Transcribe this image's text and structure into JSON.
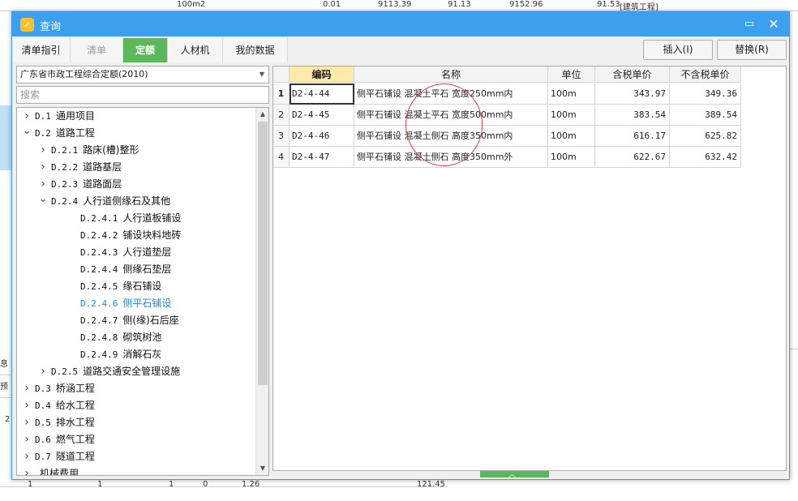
{
  "window": {
    "title": "查询",
    "app_icon": "app-logo-icon",
    "max_icon": "maximize-icon",
    "close_icon": "close-icon"
  },
  "background": {
    "top_row": [
      "100m2",
      "0.01",
      "9113.39",
      "91.13",
      "9152.96",
      "91.53",
      "[建筑工程]"
    ],
    "bottom_row": [
      "1",
      "1",
      "1",
      "0",
      "1.26",
      "121.45"
    ],
    "side_labels": [
      "息",
      "预",
      "2"
    ]
  },
  "tabs": [
    {
      "label": "清单指引",
      "state": "normal"
    },
    {
      "label": "清单",
      "state": "disabled"
    },
    {
      "label": "定额",
      "state": "active"
    },
    {
      "label": "人材机",
      "state": "normal"
    },
    {
      "label": "我的数据",
      "state": "normal"
    }
  ],
  "toolbar": {
    "insert_label": "插入(I)",
    "replace_label": "替换(R)"
  },
  "library": {
    "selected": "广东省市政工程综合定额(2010)"
  },
  "search": {
    "placeholder": "搜索",
    "value": ""
  },
  "tree": [
    {
      "code": "D.1",
      "label": "通用项目",
      "level": 0,
      "expander": "collapsed"
    },
    {
      "code": "D.2",
      "label": "道路工程",
      "level": 0,
      "expander": "expanded"
    },
    {
      "code": "D.2.1",
      "label": "路床(槽)整形",
      "level": 1,
      "expander": "collapsed"
    },
    {
      "code": "D.2.2",
      "label": "道路基层",
      "level": 1,
      "expander": "collapsed"
    },
    {
      "code": "D.2.3",
      "label": "道路面层",
      "level": 1,
      "expander": "collapsed"
    },
    {
      "code": "D.2.4",
      "label": "人行道侧缘石及其他",
      "level": 1,
      "expander": "expanded"
    },
    {
      "code": "D.2.4.1",
      "label": "人行道板铺设",
      "level": 2,
      "expander": "none"
    },
    {
      "code": "D.2.4.2",
      "label": "铺设块料地砖",
      "level": 2,
      "expander": "none"
    },
    {
      "code": "D.2.4.3",
      "label": "人行道垫层",
      "level": 2,
      "expander": "none"
    },
    {
      "code": "D.2.4.4",
      "label": "侧缘石垫层",
      "level": 2,
      "expander": "none"
    },
    {
      "code": "D.2.4.5",
      "label": "缘石铺设",
      "level": 2,
      "expander": "none"
    },
    {
      "code": "D.2.4.6",
      "label": "侧平石铺设",
      "level": 2,
      "expander": "none",
      "selected": true
    },
    {
      "code": "D.2.4.7",
      "label": "侧(缘)石后座",
      "level": 2,
      "expander": "none"
    },
    {
      "code": "D.2.4.8",
      "label": "砌筑树池",
      "level": 2,
      "expander": "none"
    },
    {
      "code": "D.2.4.9",
      "label": "消解石灰",
      "level": 2,
      "expander": "none"
    },
    {
      "code": "D.2.5",
      "label": "道路交通安全管理设施",
      "level": 1,
      "expander": "collapsed"
    },
    {
      "code": "D.3",
      "label": "桥涵工程",
      "level": 0,
      "expander": "collapsed"
    },
    {
      "code": "D.4",
      "label": "给水工程",
      "level": 0,
      "expander": "collapsed"
    },
    {
      "code": "D.5",
      "label": "排水工程",
      "level": 0,
      "expander": "collapsed"
    },
    {
      "code": "D.6",
      "label": "燃气工程",
      "level": 0,
      "expander": "collapsed"
    },
    {
      "code": "D.7",
      "label": "隧道工程",
      "level": 0,
      "expander": "collapsed"
    },
    {
      "code": "",
      "label": "机械费用",
      "level": 0,
      "expander": "collapsed"
    }
  ],
  "grid": {
    "columns": [
      "",
      "编码",
      "名称",
      "单位",
      "含税单价",
      "不含税单价"
    ],
    "rows": [
      {
        "idx": "1",
        "code": "D2-4-44",
        "name": "侧平石铺设 混凝土平石 宽度250mm内",
        "unit": "100m",
        "price_tax": "343.97",
        "price_notax": "349.36"
      },
      {
        "idx": "2",
        "code": "D2-4-45",
        "name": "侧平石铺设 混凝土平石 宽度500mm内",
        "unit": "100m",
        "price_tax": "383.54",
        "price_notax": "389.54"
      },
      {
        "idx": "3",
        "code": "D2-4-46",
        "name": "侧平石铺设 混凝土侧石 高度350mm内",
        "unit": "100m",
        "price_tax": "616.17",
        "price_notax": "625.82"
      },
      {
        "idx": "4",
        "code": "D2-4-47",
        "name": "侧平石铺设 混凝土侧石 高度350mm外",
        "unit": "100m",
        "price_tax": "622.67",
        "price_notax": "632.42"
      }
    ]
  },
  "colors": {
    "titlebar": "#3d9ff0",
    "active_tab": "#5db85c",
    "selected_tree": "#1e88e5",
    "header_highlight": "#fde9a8",
    "annotation": "#d94040"
  }
}
